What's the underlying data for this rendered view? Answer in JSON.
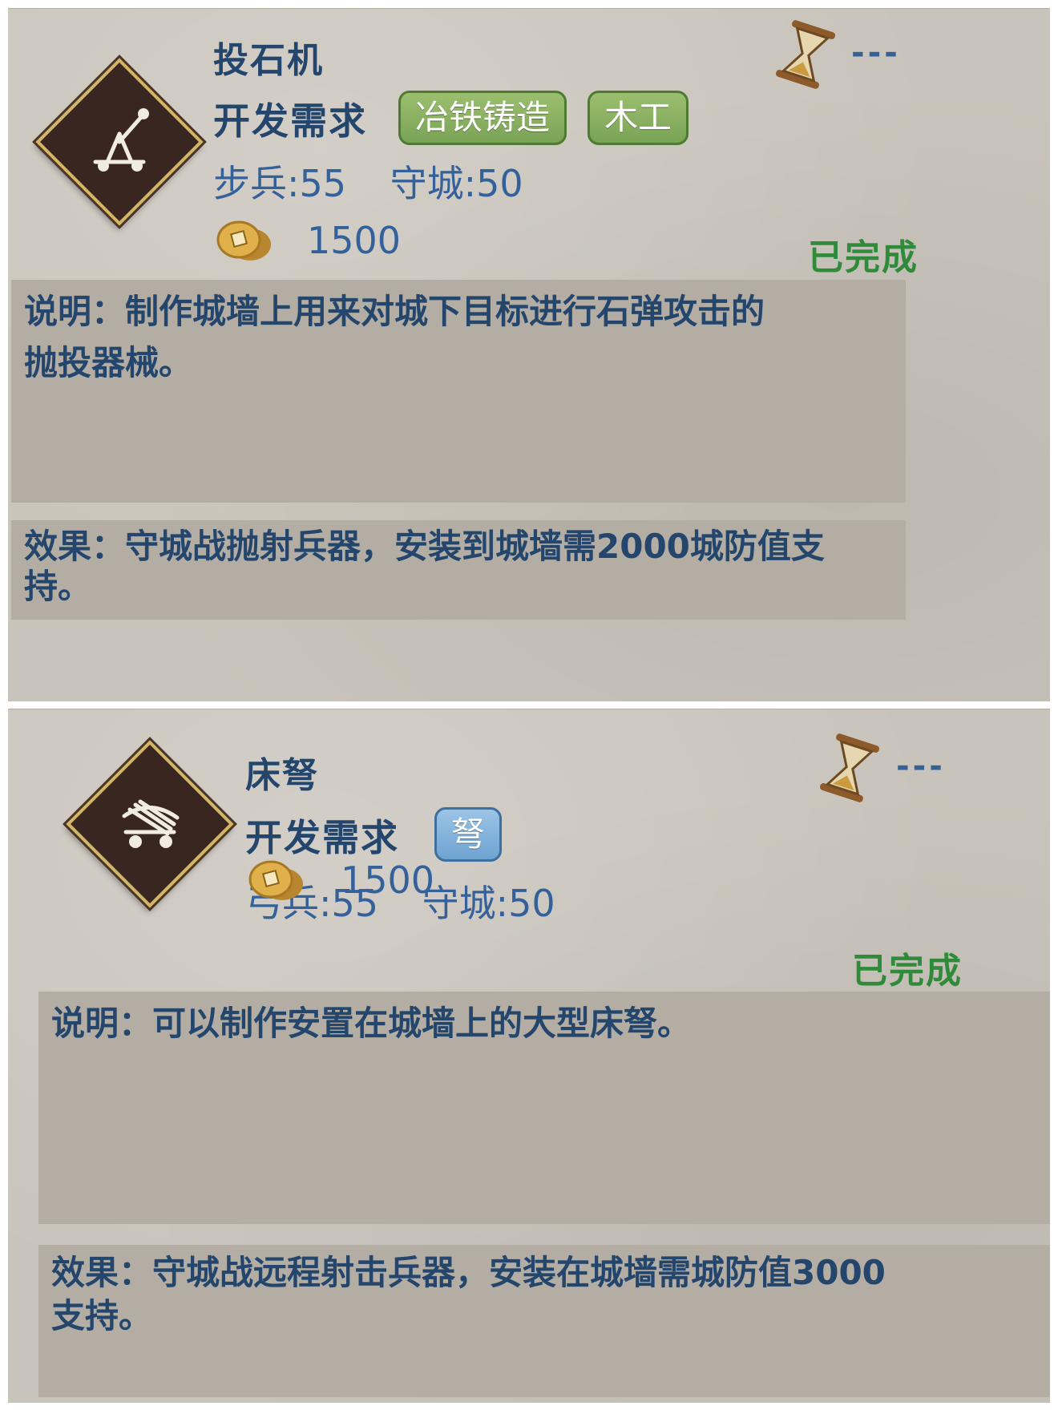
{
  "cards": [
    {
      "title": "投石机",
      "requirement_label": "开发需求",
      "tags": [
        "冶铁铸造",
        "木工"
      ],
      "stats": [
        "步兵:55",
        "守城:50"
      ],
      "cost": "1500",
      "timer": "---",
      "status": "已完成",
      "description": "说明：制作城墙上用来对城下目标进行石弹攻击的抛投器械。",
      "effect": "效果：守城战抛射兵器，安装到城墙需2000城防值支持。",
      "icon": "catapult-icon"
    },
    {
      "title": "床弩",
      "requirement_label": "开发需求",
      "tags": [
        "弩"
      ],
      "stats": [
        "弓兵:55",
        "守城:50"
      ],
      "cost": "1500",
      "timer": "---",
      "status": "已完成",
      "description": "说明：可以制作安置在城墙上的大型床弩。",
      "effect": "效果：守城战远程射击兵器，安装在城墙需城防值3000支持。",
      "icon": "ballista-icon"
    }
  ],
  "colors": {
    "title": "#24466d",
    "stat": "#35619a",
    "status": "#2f8a3a",
    "tag_green": "#7aa356",
    "tag_blue": "#6ea3d1"
  }
}
